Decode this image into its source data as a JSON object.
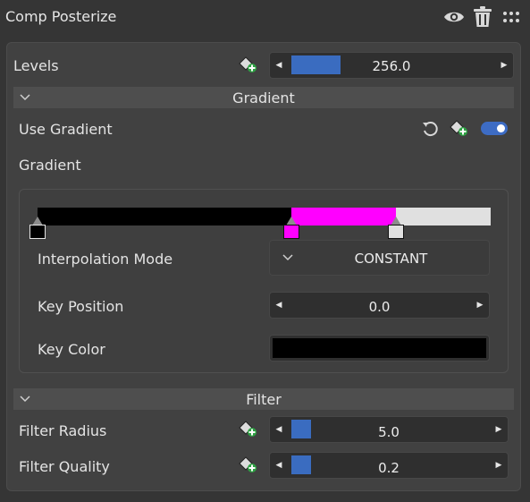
{
  "header": {
    "title": "Comp Posterize"
  },
  "levels": {
    "label": "Levels",
    "value": "256.0",
    "fill_fraction": 0.22
  },
  "gradient_section": {
    "title": "Gradient"
  },
  "use_gradient": {
    "label": "Use Gradient",
    "enabled": true
  },
  "gradient": {
    "label": "Gradient",
    "stops": [
      {
        "position": 0.0,
        "color": "#000000"
      },
      {
        "position": 0.56,
        "color": "#ff00ff"
      },
      {
        "position": 0.79,
        "color": "#e0e0e0"
      }
    ],
    "interpolation_label": "Interpolation Mode",
    "interpolation_value": "CONSTANT",
    "key_position_label": "Key Position",
    "key_position_value": "0.0",
    "key_color_label": "Key Color",
    "key_color": "#000000"
  },
  "filter_section": {
    "title": "Filter"
  },
  "filter_radius": {
    "label": "Filter Radius",
    "value": "5.0",
    "fill_fraction": 0.09
  },
  "filter_quality": {
    "label": "Filter Quality",
    "value": "0.2",
    "fill_fraction": 0.09
  },
  "icons": {
    "visibility": "eye-icon",
    "delete": "trash-icon",
    "more": "drag-handle-icon",
    "keyframe": "add-keyframe-icon",
    "reset": "reset-icon"
  },
  "colors": {
    "accent": "#3a6cc0",
    "toggle": "#3d6cc4",
    "keyframe_plus": "#2ea043"
  }
}
